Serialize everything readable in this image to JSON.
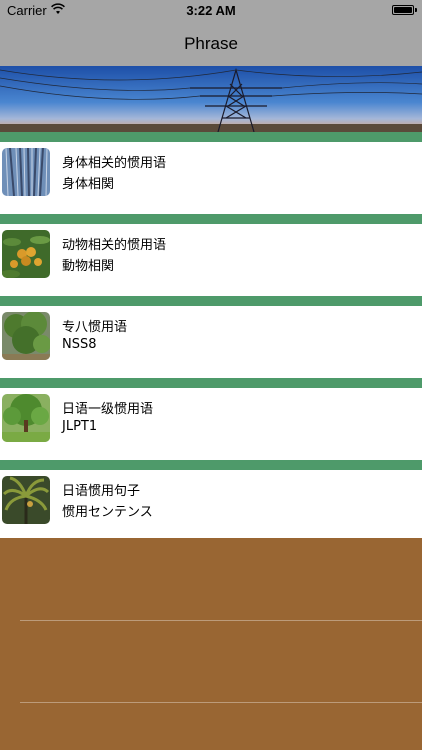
{
  "status_bar": {
    "carrier": "Carrier",
    "time": "3:22 AM",
    "battery_level": 1.0
  },
  "nav": {
    "title": "Phrase"
  },
  "rows": [
    {
      "title": "身体相关的惯用语",
      "subtitle": "身体相関",
      "thumb_icon": "willow-tree-thumbnail"
    },
    {
      "title": "动物相关的惯用语",
      "subtitle": "動物相関",
      "thumb_icon": "loquat-fruit-thumbnail"
    },
    {
      "title": "专八惯用语",
      "subtitle": "NSS8",
      "thumb_icon": "green-tree-thumbnail"
    },
    {
      "title": "日语一级惯用语",
      "subtitle": "JLPT1",
      "thumb_icon": "grass-tree-thumbnail"
    },
    {
      "title": "日语惯用句子",
      "subtitle": "惯用センテンス",
      "thumb_icon": "palm-tree-thumbnail"
    }
  ],
  "colors": {
    "bar": "#a6a6a6",
    "divider": "#4e9a6a",
    "bottom": "#996633"
  }
}
